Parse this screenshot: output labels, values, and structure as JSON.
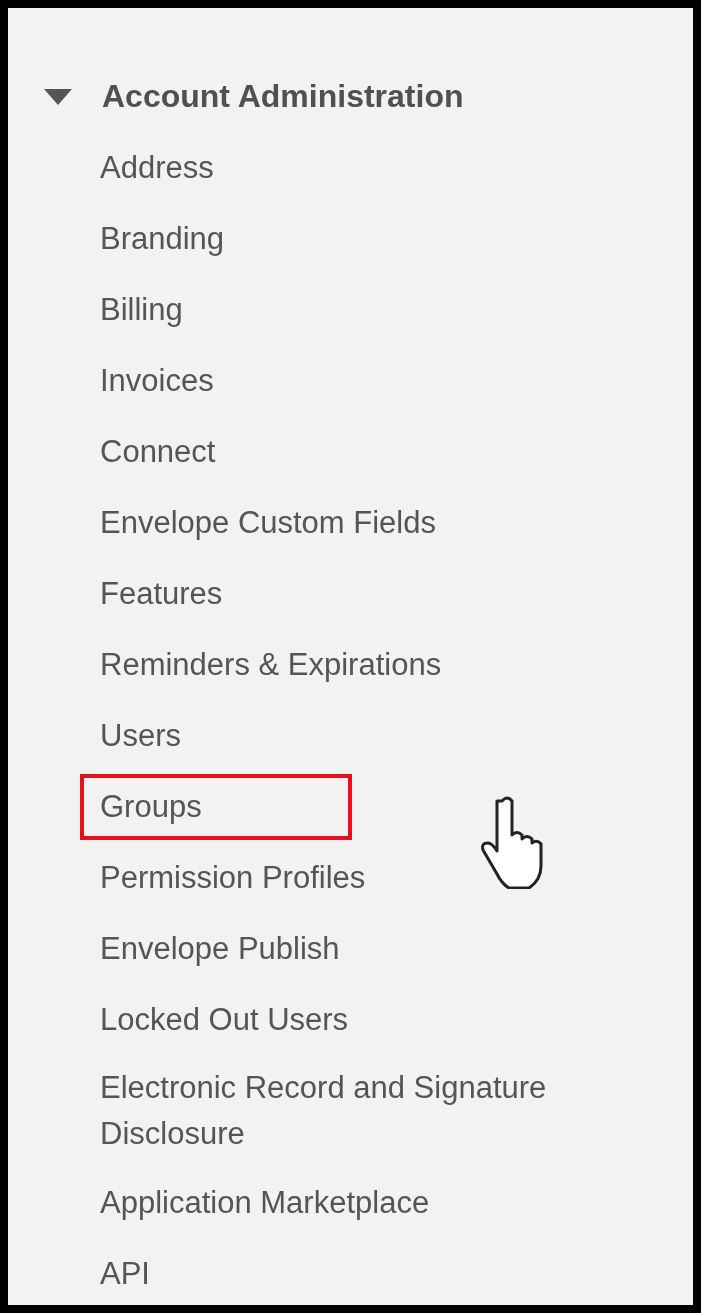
{
  "section": {
    "title": "Account Administration",
    "expanded": true,
    "items": [
      {
        "label": "Address",
        "highlighted": false
      },
      {
        "label": "Branding",
        "highlighted": false
      },
      {
        "label": "Billing",
        "highlighted": false
      },
      {
        "label": "Invoices",
        "highlighted": false
      },
      {
        "label": "Connect",
        "highlighted": false
      },
      {
        "label": "Envelope Custom Fields",
        "highlighted": false
      },
      {
        "label": "Features",
        "highlighted": false
      },
      {
        "label": "Reminders & Expirations",
        "highlighted": false
      },
      {
        "label": "Users",
        "highlighted": false
      },
      {
        "label": "Groups",
        "highlighted": true
      },
      {
        "label": "Permission Profiles",
        "highlighted": false
      },
      {
        "label": "Envelope Publish",
        "highlighted": false
      },
      {
        "label": "Locked Out Users",
        "highlighted": false
      },
      {
        "label": "Electronic Record and Signature Disclosure",
        "highlighted": false
      },
      {
        "label": "Application Marketplace",
        "highlighted": false
      },
      {
        "label": "API",
        "highlighted": false
      }
    ]
  }
}
